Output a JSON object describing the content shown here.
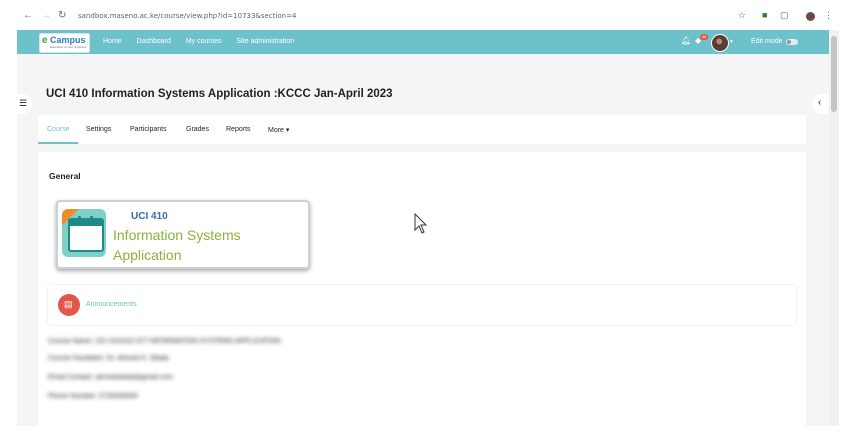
{
  "browser": {
    "url": "sandbox.maseno.ac.ke/course/view.php?id=10733&section=4"
  },
  "nav": {
    "logo": {
      "e": "e",
      "c": "Campus",
      "tagline": "Education at your fingertips"
    },
    "links": [
      "Home",
      "Dashboard",
      "My courses",
      "Site administration"
    ],
    "notification_badge": "48",
    "edit_mode_label": "Edit mode",
    "edit_mode_on": false
  },
  "course": {
    "title": "UCI 410 Information Systems Application :KCCC Jan-April 2023"
  },
  "tabs": {
    "items": [
      {
        "label": "Course",
        "active": true
      },
      {
        "label": "Settings",
        "active": false
      },
      {
        "label": "Participants",
        "active": false
      },
      {
        "label": "Grades",
        "active": false
      },
      {
        "label": "Reports",
        "active": false
      },
      {
        "label": "More ▾",
        "active": false
      }
    ]
  },
  "section": {
    "title": "General",
    "banner": {
      "code": "UCI 410",
      "line1": "Information Systems",
      "line2": "Application"
    },
    "activity": {
      "label": "Announcements",
      "icon": "forum-icon"
    },
    "blurred_lines": [
      "Course Name: UCI 410/410 ICT INFORMATION SYSTEMS APPLICATION",
      "Course Facilitator: Dr. Ahmed K. Obala",
      "Email Contact: ahmedobala@gmail.com",
      "Phone Number: 0720000000"
    ]
  },
  "colors": {
    "brand": "#6dc1cb",
    "accent_red": "#e2574c",
    "banner_text": "#8bb23b"
  }
}
